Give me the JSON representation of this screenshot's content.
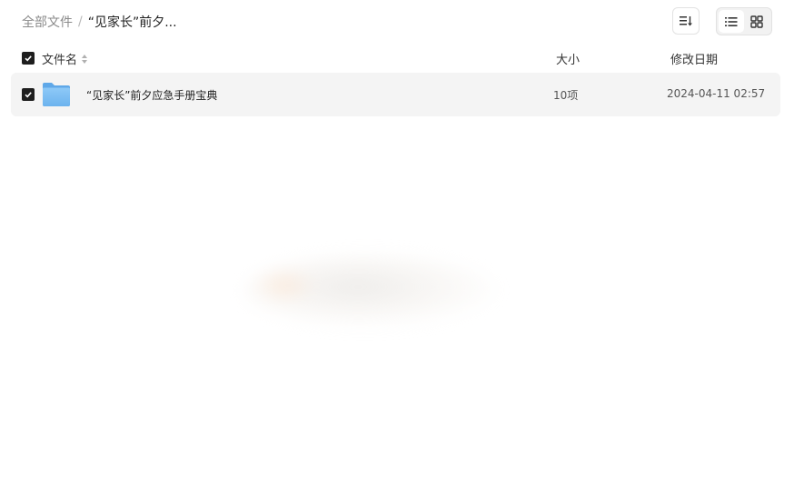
{
  "breadcrumb": {
    "root": "全部文件",
    "separator": "/",
    "current": "“见家长”前夕..."
  },
  "toolbar": {
    "sort_icon": "sort-lines-icon",
    "view_list_icon": "list-view-icon",
    "view_grid_icon": "grid-view-icon",
    "active_view": "list"
  },
  "table": {
    "headers": {
      "name": "文件名",
      "size": "大小",
      "date": "修改日期"
    },
    "rows": [
      {
        "icon": "folder-icon",
        "name": "“见家长”前夕应急手册宝典",
        "size": "10项",
        "date": "2024-04-11 02:57",
        "checked": true
      }
    ]
  },
  "colors": {
    "folder": "#7fbcf3",
    "checkbox": "#1e1e1e",
    "row_bg": "#f4f4f4"
  }
}
